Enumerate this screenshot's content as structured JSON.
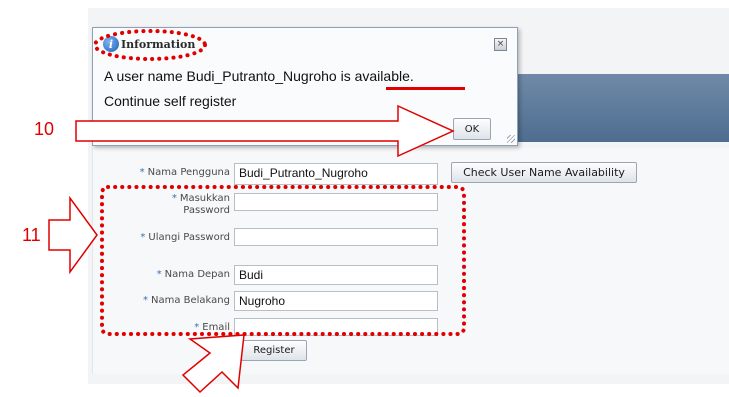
{
  "dialog": {
    "title": "Information",
    "message_prefix": "A user name Budi_Putranto_Nugroho is ",
    "message_highlight": "available.",
    "message_line2": "Continue self register",
    "ok_label": "OK",
    "close_glyph": "×",
    "info_glyph": "i"
  },
  "form": {
    "username": {
      "label": "Nama Pengguna",
      "value": "Budi_Putranto_Nugroho"
    },
    "check_button_label": "Check User Name Availability",
    "password": {
      "label_line1": "Masukkan",
      "label_line2": "Password",
      "value": ""
    },
    "confirm_password": {
      "label": "Ulangi Password",
      "value": ""
    },
    "first_name": {
      "label": "Nama Depan",
      "value": "Budi"
    },
    "last_name": {
      "label": "Nama Belakang",
      "value": "Nugroho"
    },
    "email": {
      "label": "Email",
      "value": ""
    },
    "register_label": "Register",
    "required_marker": "*"
  },
  "annotations": {
    "step_10": "10",
    "step_11": "11",
    "color": "#e00000"
  },
  "icons": [
    "info-icon",
    "close-icon",
    "resize-grip-icon",
    "annotation-arrow-right",
    "annotation-arrow-up"
  ]
}
